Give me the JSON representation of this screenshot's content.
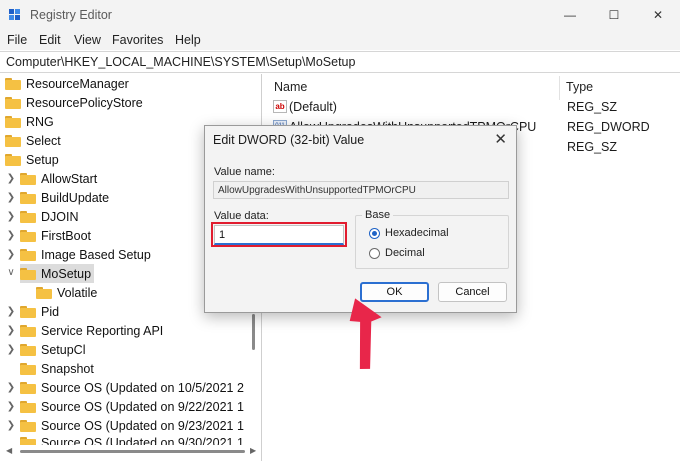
{
  "window": {
    "title": "Registry Editor",
    "controls": {
      "minimize": "—",
      "maximize": "☐",
      "close": "✕"
    }
  },
  "menu": [
    "File",
    "Edit",
    "View",
    "Favorites",
    "Help"
  ],
  "address": "Computer\\HKEY_LOCAL_MACHINE\\SYSTEM\\Setup\\MoSetup",
  "tree": {
    "items": [
      {
        "label": "ResourceManager",
        "expandable": false
      },
      {
        "label": "ResourcePolicyStore",
        "expandable": false
      },
      {
        "label": "RNG",
        "expandable": false
      },
      {
        "label": "Select",
        "expandable": false
      },
      {
        "label": "Setup",
        "expandable": false
      },
      {
        "label": "AllowStart",
        "expandable": true
      },
      {
        "label": "BuildUpdate",
        "expandable": true
      },
      {
        "label": "DJOIN",
        "expandable": true
      },
      {
        "label": "FirstBoot",
        "expandable": true
      },
      {
        "label": "Image Based Setup",
        "expandable": true
      },
      {
        "label": "MoSetup",
        "expandable": true,
        "expanded": true,
        "selected": true
      },
      {
        "label": "Volatile",
        "expandable": false
      },
      {
        "label": "Pid",
        "expandable": true
      },
      {
        "label": "Service Reporting API",
        "expandable": true
      },
      {
        "label": "SetupCl",
        "expandable": true
      },
      {
        "label": "Snapshot",
        "expandable": false
      },
      {
        "label": "Source OS (Updated on 10/5/2021 2",
        "expandable": true
      },
      {
        "label": "Source OS (Updated on 9/22/2021 1",
        "expandable": true
      },
      {
        "label": "Source OS (Updated on 9/23/2021 1",
        "expandable": true
      },
      {
        "label": "Source OS (Updated on 9/30/2021 1",
        "expandable": true
      }
    ]
  },
  "values": {
    "columns": {
      "name": "Name",
      "type": "Type"
    },
    "rows": [
      {
        "name": "(Default)",
        "type": "REG_SZ",
        "icon": "ab-string-icon"
      },
      {
        "name": "AllowUpgradesWithUnsupportedTPMOrCPU",
        "type": "REG_DWORD",
        "icon": "binary-value-icon"
      },
      {
        "name": "",
        "type": "REG_SZ",
        "icon": "ab-string-icon"
      }
    ]
  },
  "dialog": {
    "title": "Edit DWORD (32-bit) Value",
    "value_name_label": "Value name:",
    "value_name": "AllowUpgradesWithUnsupportedTPMOrCPU",
    "value_data_label": "Value data:",
    "value_data": "1",
    "base_label": "Base",
    "base_options": [
      {
        "label": "Hexadecimal",
        "selected": true
      },
      {
        "label": "Decimal",
        "selected": false
      }
    ],
    "ok_label": "OK",
    "cancel_label": "Cancel",
    "close_glyph": "✕"
  },
  "colors": {
    "highlight_box": "#e11c2f",
    "pointer_arrow": "#e8264a",
    "accent": "#2b6fd1"
  }
}
